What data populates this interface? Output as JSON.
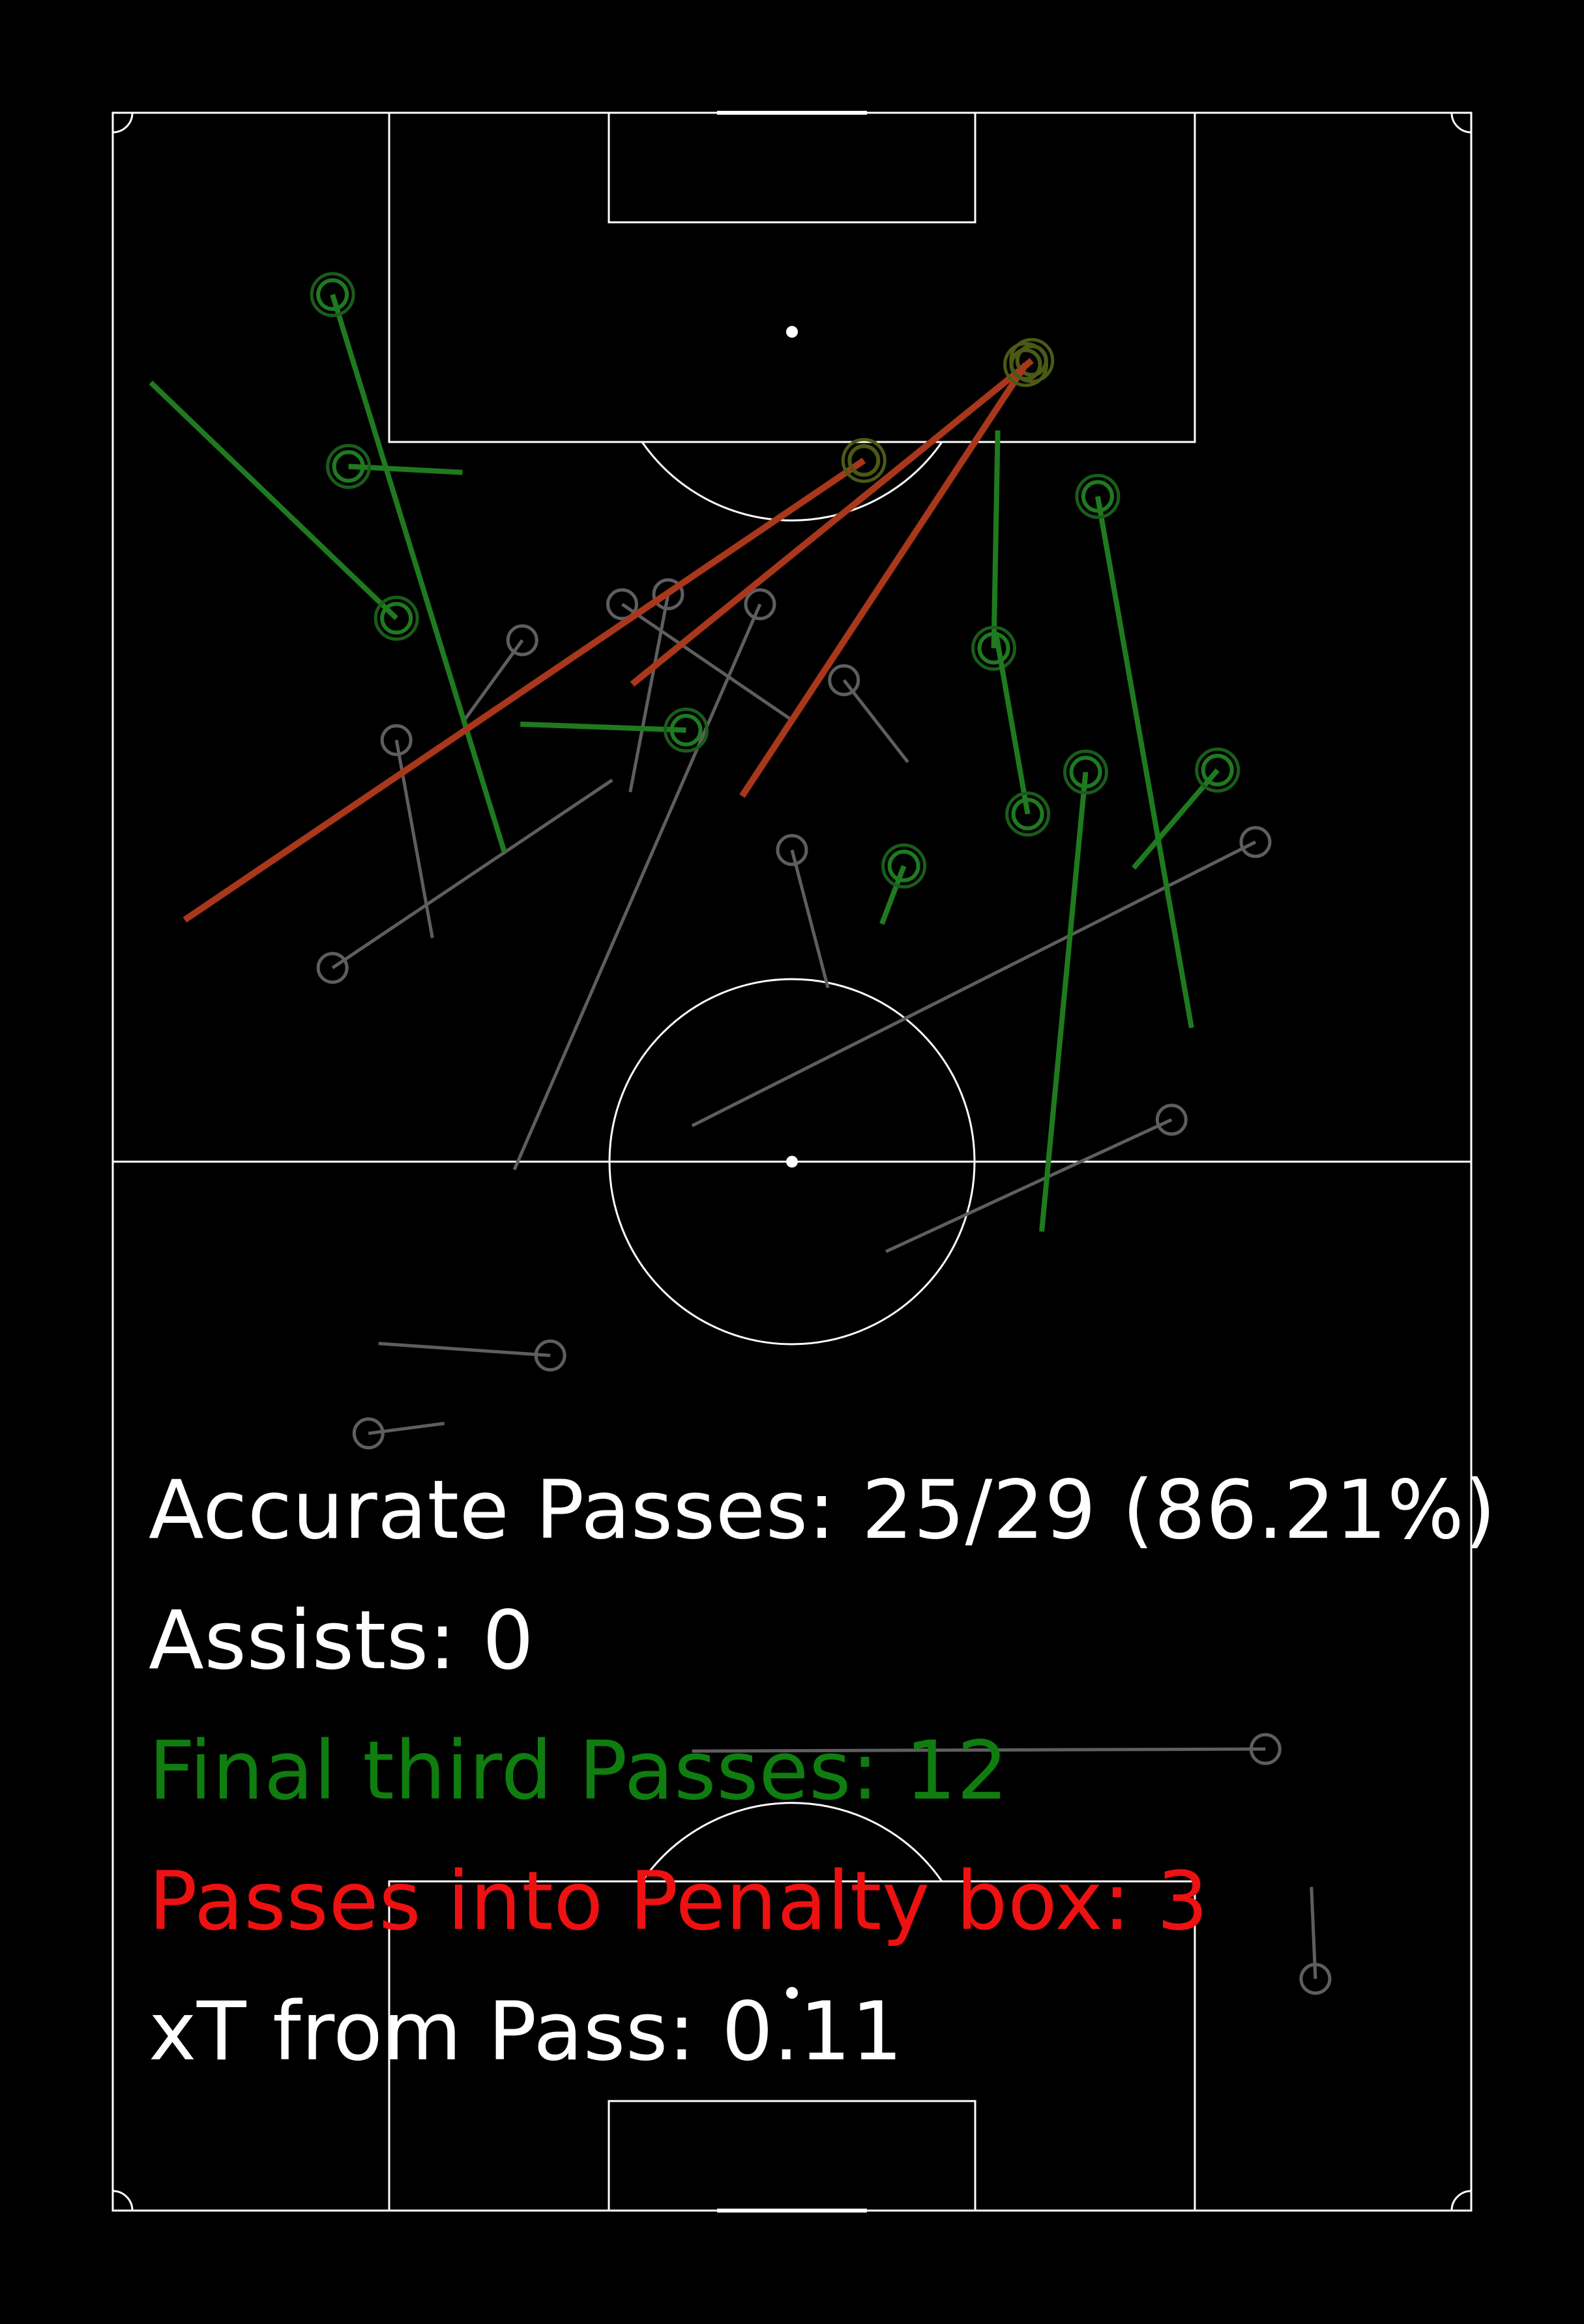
{
  "colors": {
    "background": "#000000",
    "pitch_lines": "#ffffff",
    "normal_pass": "#5e5e5e",
    "final_third_pass": "#1f7a1f",
    "penalty_box_pass": "#a8371c",
    "final_third_marker": "#1a5c1a",
    "penalty_marker": "#4a5a14",
    "text_default": "#ffffff",
    "text_final_third": "#0f7d0f",
    "text_penalty": "#ee1111"
  },
  "stats": {
    "accurate": "Accurate Passes: 25/29 (86.21%)",
    "assists": "Assists: 0",
    "final_third": "Final third Passes: 12",
    "penalty": "Passes into Penalty box: 3",
    "xt": "xT from Pass: 0.11"
  },
  "chart_data": {
    "type": "scatter",
    "description_keys": "pitch in data units: x 0-68 (width), y 0-105 (length, attacking upward); each pass has start (x1,y1) and end (x2,y2, marker end)",
    "pitch": {
      "width": 68,
      "length": 105
    },
    "passes": [
      {
        "category": "normal",
        "x1": 16.6,
        "y1": 39.4,
        "x2": 12.8,
        "y2": 38.9
      },
      {
        "category": "normal",
        "x1": 13.3,
        "y1": 43.4,
        "x2": 21.9,
        "y2": 42.8
      },
      {
        "category": "normal",
        "x1": 29.0,
        "y1": 23.0,
        "x2": 57.7,
        "y2": 23.1
      },
      {
        "category": "normal",
        "x1": 60.0,
        "y1": 16.2,
        "x2": 60.2,
        "y2": 11.6
      },
      {
        "category": "normal",
        "x1": 25.0,
        "y1": 71.6,
        "x2": 11.0,
        "y2": 62.2
      },
      {
        "category": "normal",
        "x1": 20.1,
        "y1": 52.1,
        "x2": 32.4,
        "y2": 80.4
      },
      {
        "category": "normal",
        "x1": 29.0,
        "y1": 54.3,
        "x2": 57.2,
        "y2": 68.5
      },
      {
        "category": "normal",
        "x1": 38.7,
        "y1": 48.0,
        "x2": 53.0,
        "y2": 54.6
      },
      {
        "category": "normal",
        "x1": 39.8,
        "y1": 72.5,
        "x2": 36.6,
        "y2": 76.6
      },
      {
        "category": "normal",
        "x1": 16.0,
        "y1": 63.7,
        "x2": 14.2,
        "y2": 73.6
      },
      {
        "category": "normal",
        "x1": 17.6,
        "y1": 74.6,
        "x2": 20.5,
        "y2": 78.6
      },
      {
        "category": "normal",
        "x1": 25.9,
        "y1": 71.0,
        "x2": 27.8,
        "y2": 80.9
      },
      {
        "category": "normal",
        "x1": 34.0,
        "y1": 74.6,
        "x2": 25.5,
        "y2": 80.4
      },
      {
        "category": "normal",
        "x1": 35.8,
        "y1": 61.2,
        "x2": 34.0,
        "y2": 68.1
      },
      {
        "category": "final_third",
        "x1": 19.6,
        "y1": 68.0,
        "x2": 11.0,
        "y2": 95.9
      },
      {
        "category": "final_third",
        "x1": 1.9,
        "y1": 91.5,
        "x2": 14.2,
        "y2": 79.7
      },
      {
        "category": "final_third",
        "x1": 17.5,
        "y1": 87.0,
        "x2": 11.8,
        "y2": 87.3
      },
      {
        "category": "final_third",
        "x1": 20.4,
        "y1": 74.4,
        "x2": 28.7,
        "y2": 74.1
      },
      {
        "category": "final_third",
        "x1": 44.3,
        "y1": 89.1,
        "x2": 44.1,
        "y2": 78.2
      },
      {
        "category": "final_third",
        "x1": 44.2,
        "y1": 79.0,
        "x2": 45.8,
        "y2": 69.9
      },
      {
        "category": "final_third",
        "x1": 54.0,
        "y1": 59.2,
        "x2": 49.3,
        "y2": 85.8
      },
      {
        "category": "final_third",
        "x1": 46.5,
        "y1": 49.0,
        "x2": 48.7,
        "y2": 72.0
      },
      {
        "category": "final_third",
        "x1": 51.1,
        "y1": 67.2,
        "x2": 55.3,
        "y2": 72.1
      },
      {
        "category": "final_third",
        "x1": 38.5,
        "y1": 64.4,
        "x2": 39.6,
        "y2": 67.3
      },
      {
        "category": "penalty_box",
        "x1": 3.6,
        "y1": 64.6,
        "x2": 37.6,
        "y2": 87.6
      },
      {
        "category": "penalty_box",
        "x1": 26.0,
        "y1": 76.4,
        "x2": 46.0,
        "y2": 92.6
      },
      {
        "category": "penalty_box",
        "x1": 31.5,
        "y1": 70.8,
        "x2": 45.7,
        "y2": 92.4
      }
    ]
  }
}
